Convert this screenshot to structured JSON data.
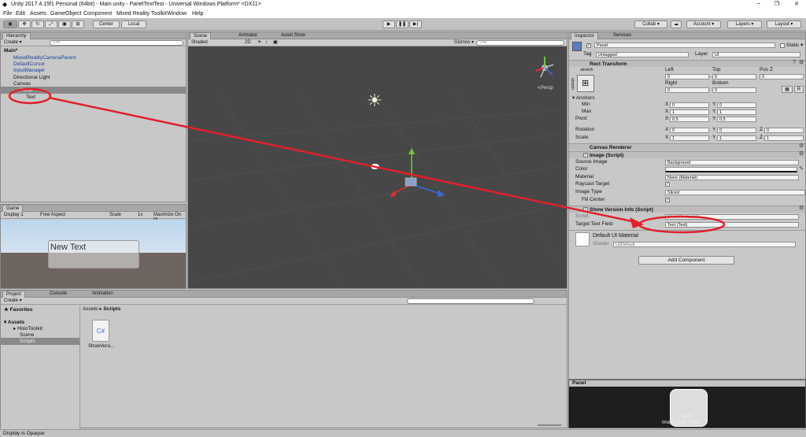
{
  "window": {
    "title": "Unity 2017.4.15f1 Personal (64bit) - Main.unity - PanelTextTest - Universal Windows Platform* <DX11>",
    "min": "–",
    "max": "❐",
    "close": "✕"
  },
  "menu": [
    "File",
    "Edit",
    "Assets",
    "GameObject",
    "Component",
    "Mixed Reality Toolkit",
    "Window",
    "Help"
  ],
  "toolbar": {
    "center": "Center",
    "local": "Local",
    "collab": "Collab ▾",
    "account": "Account ▾",
    "layers": "Layers ▾",
    "layout": "Layout ▾"
  },
  "hierarchy": {
    "tab": "Hierarchy",
    "create": "Create ▾",
    "search": "⚲All",
    "scene": "Main*",
    "items": [
      "MixedRealityCameraParent",
      "DefaultCursor",
      "InputManager",
      "Directional Light",
      "Canvas",
      "Panel",
      "Text"
    ]
  },
  "scene_view": {
    "tabs": [
      "Scene",
      "Animator",
      "Asset Store"
    ],
    "shading": "Shaded",
    "mode2d": "2D",
    "gizmos": "Gizmos ▾",
    "search": "⚲All",
    "persp": "≺Persp"
  },
  "game_view": {
    "tab": "Game",
    "display": "Display 1",
    "aspect": "Free Aspect",
    "scale_label": "Scale",
    "scale_value": "1x",
    "maximize": "Maximize On Pl",
    "text": "New Text"
  },
  "project": {
    "tabs": [
      "Project",
      "Console",
      "Animation"
    ],
    "create": "Create ▾",
    "favorites": "Favorites",
    "assets": "Assets",
    "folders": [
      "HoloToolkit",
      "Scene",
      "Scripts"
    ],
    "breadcrumb": [
      "Assets",
      "Scripts"
    ],
    "file": "ShowVersi...",
    "file_icon": "C#"
  },
  "inspector": {
    "tabs": [
      "Inspector",
      "Services"
    ],
    "object_name": "Panel",
    "static": "Static ▾",
    "tag_label": "Tag",
    "tag_value": "Untagged",
    "layer_label": "Layer",
    "layer_value": "UI",
    "rect": {
      "title": "Rect Transform",
      "stretch": "stretch",
      "stretch_side": "stretch",
      "headers": [
        "Left",
        "Top",
        "Pos Z",
        "Right",
        "Bottom"
      ],
      "values": [
        "0",
        "0",
        "0",
        "0",
        "0"
      ],
      "r_label": "R",
      "anchors": "Anchors",
      "min": "Min",
      "max": "Max",
      "pivot": "Pivot",
      "min_x": "0",
      "min_y": "0",
      "max_x": "1",
      "max_y": "1",
      "pivot_x": "0.5",
      "pivot_y": "0.5",
      "rotation": "Rotation",
      "rot": [
        "0",
        "0",
        "0"
      ],
      "scale": "Scale",
      "scl": [
        "1",
        "1",
        "1"
      ]
    },
    "canvas_renderer": "Canvas Renderer",
    "image": {
      "title": "Image (Script)",
      "source_label": "Source Image",
      "source_value": "Background",
      "color_label": "Color",
      "material_label": "Material",
      "material_value": "None (Material)",
      "raycast_label": "Raycast Target",
      "type_label": "Image Type",
      "type_value": "Sliced",
      "fill_label": "Fill Center"
    },
    "show_version": {
      "title": "Show Version Info (Script)",
      "script_label": "Script",
      "script_value": "ShowVersionInfo",
      "target_label": "Target Text Field",
      "target_value": "Text (Text)"
    },
    "material": {
      "name": "Default UI Material",
      "shader_label": "Shader",
      "shader_value": "UI/Default"
    },
    "add_component": "Add Component",
    "preview_tab": "Panel",
    "preview_caption": "Panel",
    "preview_size": "Image Size: 32x32"
  },
  "status": "Display is Opaque",
  "colors": {
    "annotation": "#e0202a",
    "scene_bg": "#474747",
    "sky": "#bcd6ec",
    "ground": "#6e6460"
  }
}
